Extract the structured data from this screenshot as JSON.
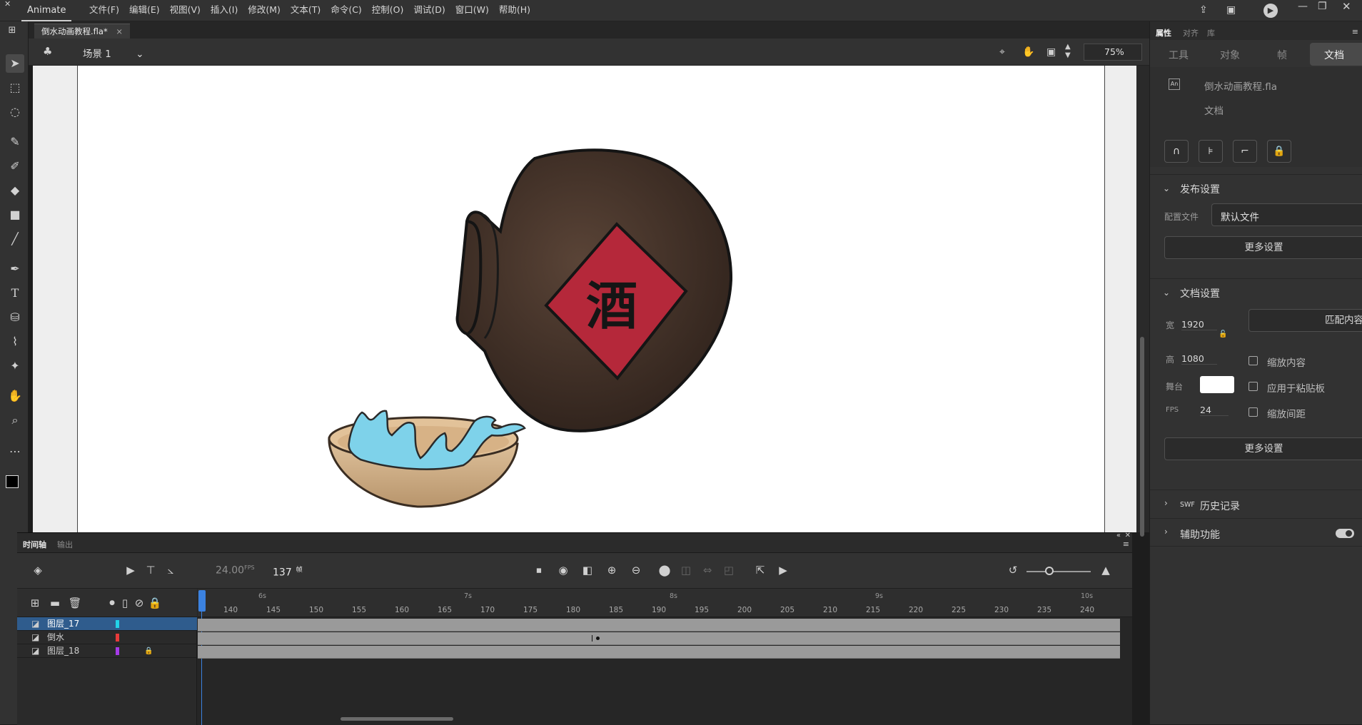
{
  "menubar": {
    "app_name": "Animate",
    "menus": [
      "文件(F)",
      "编辑(E)",
      "视图(V)",
      "插入(I)",
      "修改(M)",
      "文本(T)",
      "命令(C)",
      "控制(O)",
      "调试(D)",
      "窗口(W)",
      "帮助(H)"
    ]
  },
  "document": {
    "tab_title": "倒水动画教程.fla*",
    "scene_label": "场景 1",
    "zoom": "75%"
  },
  "stage": {
    "jar_label_char": "酒"
  },
  "properties": {
    "panel_tabs": [
      "属性",
      "对齐",
      "库"
    ],
    "sub_tabs": [
      "工具",
      "对象",
      "帧",
      "文档"
    ],
    "active_sub_tab": "文档",
    "file_name": "倒水动画教程.fla",
    "file_kind": "文档",
    "file_badge": "An",
    "publish": {
      "title": "发布设置",
      "profile_label": "配置文件",
      "profile_value": "默认文件",
      "more_button": "更多设置"
    },
    "doc_settings": {
      "title": "文档设置",
      "width_label": "宽",
      "width_value": "1920",
      "height_label": "高",
      "height_value": "1080",
      "match_button": "匹配内容",
      "stage_label": "舞台",
      "stage_color": "#ffffff",
      "fps_label": "FPS",
      "fps_value": "24",
      "scale_content": "缩放内容",
      "apply_pasteboard": "应用于粘贴板",
      "scale_spacing": "缩放间距",
      "more_button": "更多设置"
    },
    "swf_history": {
      "prefix": "SWF",
      "title": "历史记录"
    },
    "accessibility": {
      "title": "辅助功能"
    }
  },
  "timeline": {
    "tabs": [
      "时间轴",
      "输出"
    ],
    "fps_display": "24.00",
    "fps_unit": "FPS",
    "current_frame": "137",
    "frame_unit": "帧",
    "frame_ticks": [
      "140",
      "145",
      "150",
      "155",
      "160",
      "165",
      "170",
      "175",
      "180",
      "185",
      "190",
      "195",
      "200",
      "205",
      "210",
      "215",
      "220",
      "225",
      "230",
      "235",
      "240"
    ],
    "second_ticks": [
      "6s",
      "7s",
      "8s",
      "9s",
      "10s"
    ],
    "layers": [
      {
        "name": "图层_17",
        "color": "#22d3e8",
        "selected": true,
        "locked": false
      },
      {
        "name": "倒水",
        "color": "#e83a3a",
        "selected": false,
        "locked": false
      },
      {
        "name": "图层_18",
        "color": "#a63ae8",
        "selected": false,
        "locked": true
      }
    ]
  }
}
